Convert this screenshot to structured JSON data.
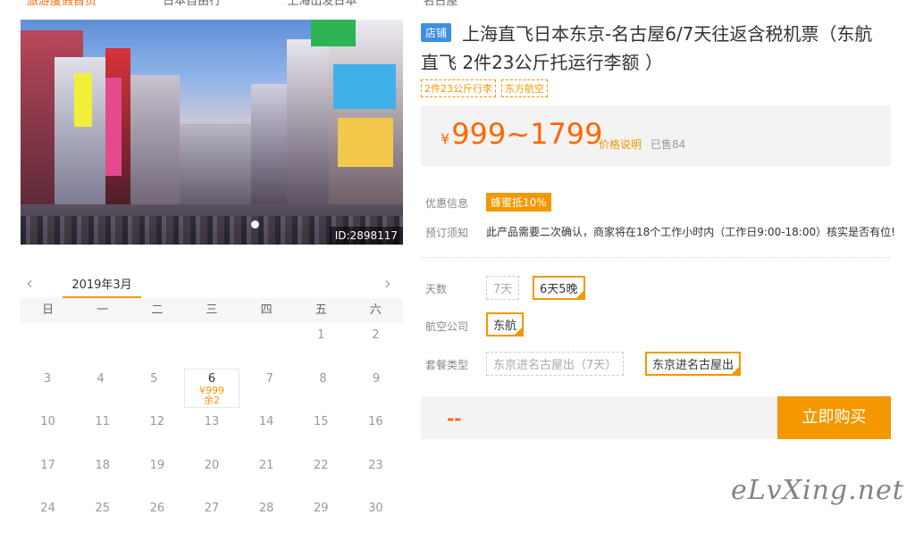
{
  "breadcrumb": [
    "旅游度假首页",
    "日本自由行",
    "上海出发日本",
    "名古屋"
  ],
  "photo": {
    "id_label": "ID:2898117"
  },
  "calendar": {
    "month": "2019年3月",
    "weekdays": [
      "日",
      "一",
      "二",
      "三",
      "四",
      "五",
      "六"
    ],
    "rows": [
      [
        "",
        "",
        "",
        "",
        "",
        "1",
        "2"
      ],
      [
        "3",
        "4",
        "5",
        "6",
        "7",
        "8",
        "9"
      ],
      [
        "10",
        "11",
        "12",
        "13",
        "14",
        "15",
        "16"
      ],
      [
        "17",
        "18",
        "19",
        "20",
        "21",
        "22",
        "23"
      ],
      [
        "24",
        "25",
        "26",
        "27",
        "28",
        "29",
        "30"
      ]
    ],
    "selected": {
      "day": "6",
      "price": "¥999",
      "stock": "余2"
    }
  },
  "product": {
    "shop_tag": "店铺",
    "title": "上海直飞日本东京-名古屋6/7天往返含税机票（东航直飞 2件23公斤托运行李额 ）",
    "chips": [
      "2件23公斤行李",
      "东方航空"
    ],
    "price_symbol": "¥",
    "price_range": "999~1799",
    "price_note": "价格说明",
    "sold": "已售84"
  },
  "info": {
    "discount_label": "优惠信息",
    "discount_value": "蜂蜜抵10%",
    "notice_label": "预订须知",
    "notice_value": "此产品需要二次确认，商家将在18个工作小时内（工作日9:00-18:00）核实是否有位!"
  },
  "options": {
    "days_label": "天数",
    "days": [
      "7天",
      "6天5晚"
    ],
    "airline_label": "航空公司",
    "airline": [
      "东航"
    ],
    "package_label": "套餐类型",
    "packages": [
      "东京进名古屋出（7天）",
      "东京进名古屋出"
    ]
  },
  "purchase": {
    "total": "--",
    "buy_label": "立即购买"
  },
  "watermark": "eLvXing.net"
}
